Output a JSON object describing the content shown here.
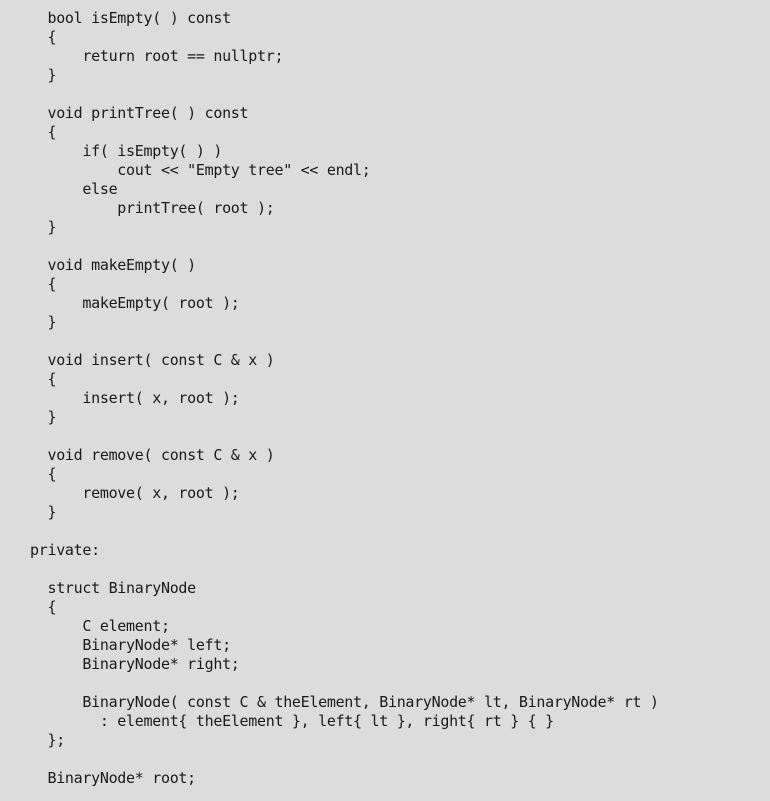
{
  "document": {
    "kind": "source-code-listing",
    "language": "C++",
    "background_color": "#dcdcdc",
    "text_color": "#1a1a1a",
    "indent_unit_spaces": 4,
    "lines": [
      "  bool isEmpty( ) const",
      "  {",
      "      return root == nullptr;",
      "  }",
      "",
      "  void printTree( ) const",
      "  {",
      "      if( isEmpty( ) )",
      "          cout << \"Empty tree\" << endl;",
      "      else",
      "          printTree( root );",
      "  }",
      "",
      "  void makeEmpty( )",
      "  {",
      "      makeEmpty( root );",
      "  }",
      "",
      "  void insert( const C & x )",
      "  {",
      "      insert( x, root );",
      "  }",
      "",
      "  void remove( const C & x )",
      "  {",
      "      remove( x, root );",
      "  }",
      "",
      "private:",
      "",
      "  struct BinaryNode",
      "  {",
      "      C element;",
      "      BinaryNode* left;",
      "      BinaryNode* right;",
      "",
      "      BinaryNode( const C & theElement, BinaryNode* lt, BinaryNode* rt )",
      "        : element{ theElement }, left{ lt }, right{ rt } { }",
      "  };",
      "",
      "  BinaryNode* root;"
    ]
  }
}
